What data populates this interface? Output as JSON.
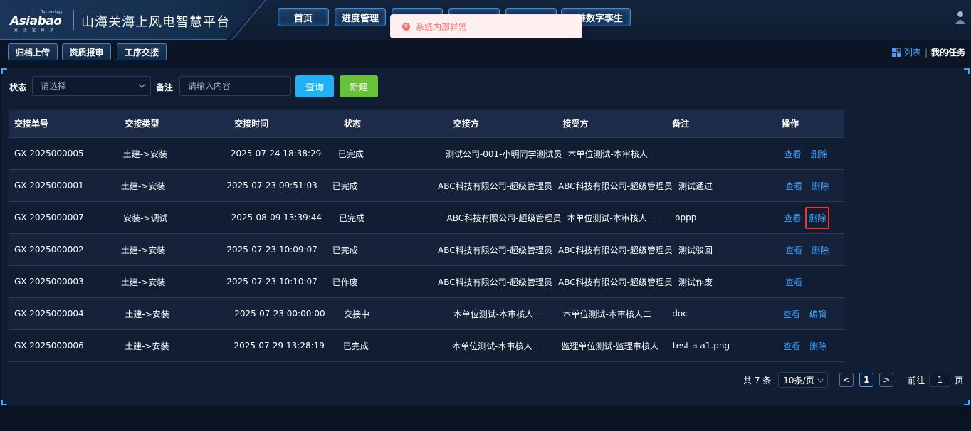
{
  "header": {
    "logo_small": "Technology",
    "logo_main": "Asiabao",
    "logo_sub": "嘉 士 宝 科 技",
    "title": "山海关海上风电智慧平台",
    "nav_tabs": [
      {
        "label": "首页"
      },
      {
        "label": "进度管理"
      },
      {
        "label": ""
      },
      {
        "label": ""
      },
      {
        "label": ""
      },
      {
        "label": "维数字孪生"
      }
    ]
  },
  "toast": {
    "message": "系统内部异常"
  },
  "subtoolbar": {
    "buttons": [
      {
        "label": "归档上传"
      },
      {
        "label": "资质报审"
      },
      {
        "label": "工序交接"
      }
    ],
    "view_list": "列表",
    "view_sep": "|",
    "view_task": "我的任务"
  },
  "filters": {
    "status_label": "状态",
    "status_placeholder": "请选择",
    "remark_label": "备注",
    "remark_placeholder": "请输入内容",
    "query_button": "查询",
    "new_button": "新建"
  },
  "table": {
    "columns": [
      "交接单号",
      "交接类型",
      "交接时间",
      "状态",
      "交接方",
      "接受方",
      "备注",
      "操作"
    ],
    "rows": [
      {
        "id": "GX-2025000005",
        "type": "土建->安装",
        "time": "2025-07-24 18:38:29",
        "status": "已完成",
        "from": "测试公司-001-小明同学测试员",
        "to": "本单位测试-本审核人一",
        "remark": "",
        "ops": [
          "查看",
          "删除"
        ]
      },
      {
        "id": "GX-2025000001",
        "type": "土建->安装",
        "time": "2025-07-23 09:51:03",
        "status": "已完成",
        "from": "ABC科技有限公司-超级管理员",
        "to": "ABC科技有限公司-超级管理员",
        "remark": "测试通过",
        "ops": [
          "查看",
          "删除"
        ]
      },
      {
        "id": "GX-2025000007",
        "type": "安装->调试",
        "time": "2025-08-09 13:39:44",
        "status": "已完成",
        "from": "ABC科技有限公司-超级管理员",
        "to": "本单位测试-本审核人一",
        "remark": "pppp",
        "ops": [
          "查看",
          "删除"
        ]
      },
      {
        "id": "GX-2025000002",
        "type": "土建->安装",
        "time": "2025-07-23 10:09:07",
        "status": "已完成",
        "from": "ABC科技有限公司-超级管理员",
        "to": "ABC科技有限公司-超级管理员",
        "remark": "测试驳回",
        "ops": [
          "查看",
          "删除"
        ]
      },
      {
        "id": "GX-2025000003",
        "type": "土建->安装",
        "time": "2025-07-23 10:10:07",
        "status": "已作废",
        "from": "ABC科技有限公司-超级管理员",
        "to": "ABC科技有限公司-超级管理员",
        "remark": "测试作废",
        "ops": [
          "查看"
        ]
      },
      {
        "id": "GX-2025000004",
        "type": "土建->安装",
        "time": "2025-07-23 00:00:00",
        "status": "交接中",
        "from": "本单位测试-本审核人一",
        "to": "本单位测试-本审核人二",
        "remark": "doc",
        "ops": [
          "查看",
          "编辑"
        ]
      },
      {
        "id": "GX-2025000006",
        "type": "土建->安装",
        "time": "2025-07-29 13:28:19",
        "status": "已完成",
        "from": "本单位测试-本审核人一",
        "to": "监理单位测试-监理审核人一",
        "remark": "test-a a1.png",
        "ops": [
          "查看",
          "删除"
        ]
      }
    ]
  },
  "pagination": {
    "total": "共 7 条",
    "page_size": "10条/页",
    "prev": "<",
    "current": "1",
    "next": ">",
    "goto_label": "前往",
    "goto_value": "1",
    "page_suffix": "页"
  },
  "colors": {
    "accent": "#3fa3ff",
    "query_button": "#20b2f5",
    "new_button": "#67c23a",
    "error": "#f56c6c",
    "focus_outline": "#e53935"
  }
}
